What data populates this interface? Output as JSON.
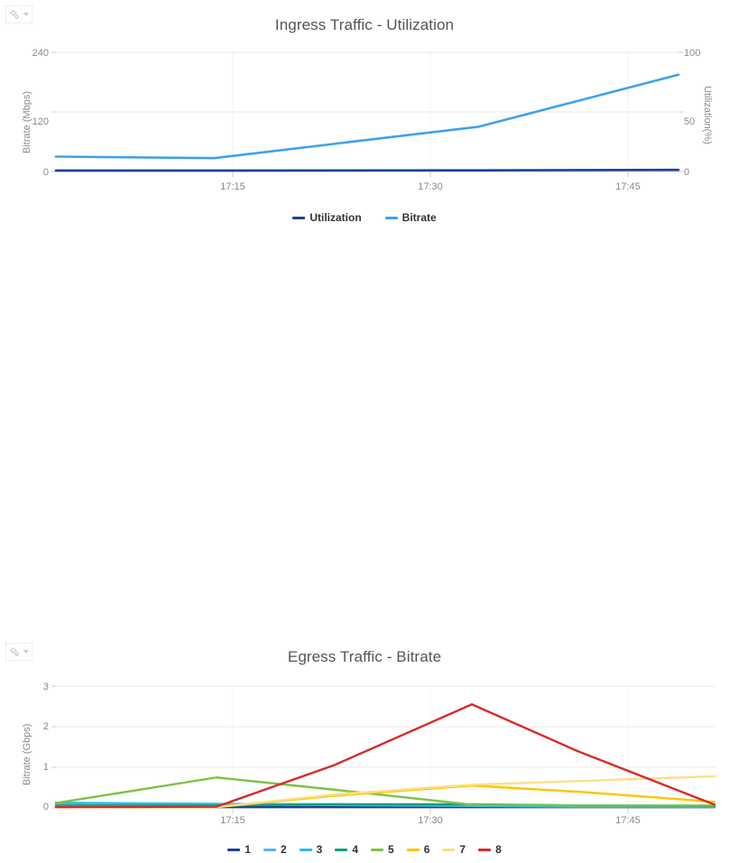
{
  "panels": [
    {
      "id": "ingress",
      "menu_icon": "gear-icon",
      "menu_caret": "chevron-down-icon",
      "title": "Ingress Traffic - Utilization"
    },
    {
      "id": "egress",
      "menu_icon": "gear-icon",
      "menu_caret": "chevron-down-icon",
      "title": "Egress Traffic - Bitrate"
    }
  ],
  "chart_data": [
    {
      "type": "line",
      "title": "Ingress Traffic - Utilization",
      "xlabel": "",
      "ylabel": "Bitrate (Mbps)",
      "y2label": "Utilization(%)",
      "grid": true,
      "legend_position": "bottom",
      "x": [
        "17:08",
        "17:17",
        "17:31",
        "17:50"
      ],
      "xticks": [
        "17:15",
        "17:30",
        "17:45"
      ],
      "yticks": [
        0,
        120,
        240
      ],
      "ylim": [
        0,
        240
      ],
      "y2ticks": [
        0,
        50,
        100
      ],
      "y2lim": [
        0,
        100
      ],
      "series": [
        {
          "name": "Utilization",
          "color": "#1f3f99",
          "axis": "right",
          "values": [
            0.8,
            0.8,
            1.0,
            1.4
          ]
        },
        {
          "name": "Bitrate",
          "color": "#3ea1ec",
          "axis": "left",
          "values": [
            30,
            27,
            90,
            195
          ]
        }
      ]
    },
    {
      "type": "line",
      "title": "Egress Traffic - Bitrate",
      "xlabel": "",
      "ylabel": "Bitrate (Gbps)",
      "grid": true,
      "legend_position": "bottom",
      "x": [
        "17:08",
        "17:18",
        "17:24",
        "17:33",
        "17:40",
        "17:50"
      ],
      "xticks": [
        "17:15",
        "17:30",
        "17:45"
      ],
      "yticks": [
        0,
        1,
        2,
        3
      ],
      "ylim": [
        0,
        3
      ],
      "series": [
        {
          "name": "1",
          "color": "#1f3f99",
          "values": [
            0.02,
            0.02,
            0.02,
            0.02,
            0.02,
            0.02
          ]
        },
        {
          "name": "2",
          "color": "#5bb4ef",
          "values": [
            0.09,
            0.07,
            0.07,
            0.05,
            0.03,
            0.03
          ]
        },
        {
          "name": "3",
          "color": "#23c2e8",
          "values": [
            0.13,
            0.1,
            0.09,
            0.06,
            0.04,
            0.03
          ]
        },
        {
          "name": "4",
          "color": "#0fa07d",
          "values": [
            0.06,
            0.06,
            0.09,
            0.09,
            0.06,
            0.05
          ]
        },
        {
          "name": "5",
          "color": "#7dc242",
          "values": [
            0.12,
            0.75,
            0.45,
            0.08,
            0.06,
            0.06
          ]
        },
        {
          "name": "6",
          "color": "#fdc500",
          "values": [
            0.02,
            0.02,
            0.3,
            0.55,
            0.4,
            0.15
          ]
        },
        {
          "name": "7",
          "color": "#fcdf84",
          "values": [
            0.02,
            0.02,
            0.33,
            0.57,
            0.66,
            0.78
          ]
        },
        {
          "name": "8",
          "color": "#d92b2b",
          "values": [
            0.02,
            0.03,
            1.05,
            2.55,
            1.4,
            0.08
          ]
        }
      ]
    }
  ]
}
